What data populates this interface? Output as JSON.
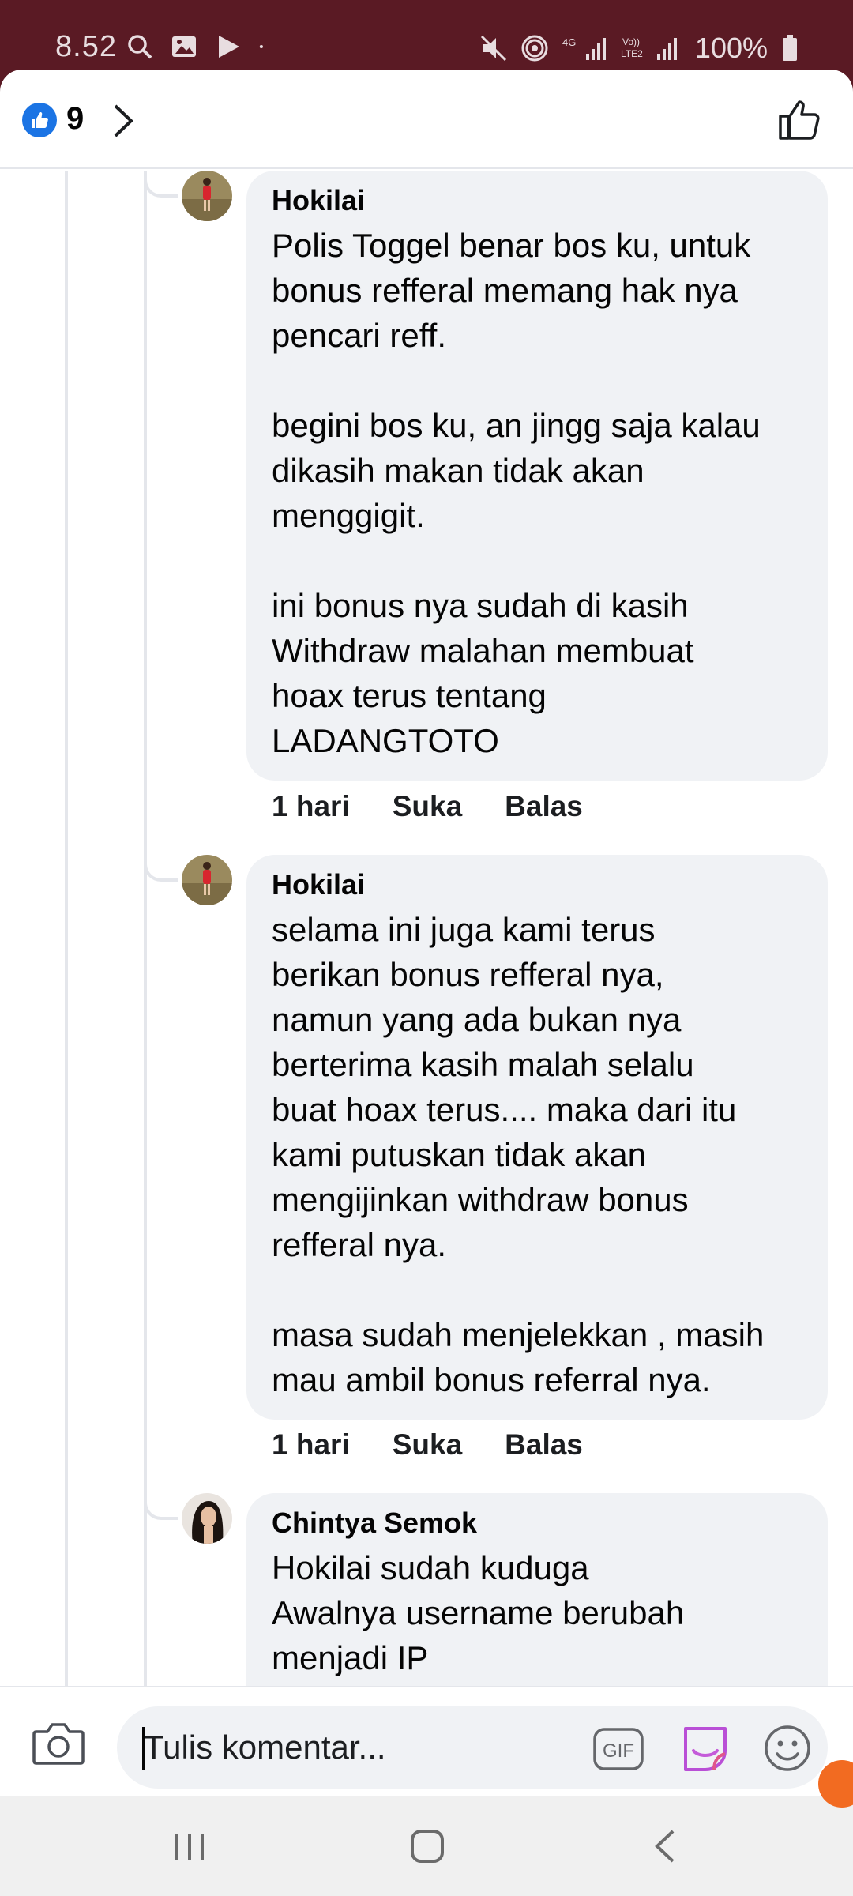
{
  "status_bar": {
    "time": "8.52",
    "network_label": "4G",
    "volte_label": "Vo)) LTE2",
    "battery": "100%"
  },
  "header": {
    "reaction_count": "9",
    "like_badge_color": "#1b74e4"
  },
  "comments": [
    {
      "author": "Hokilai",
      "text": "Polis Toggel benar bos ku, untuk\nbonus refferal memang hak nya\npencari reff.\n\nbegini bos ku, an jingg saja kalau\ndikasih makan tidak akan\nmenggigit.\n\nini bonus nya sudah di kasih\nWithdraw malahan membuat\nhoax terus tentang\nLADANGTOTO",
      "time": "1 hari",
      "like_label": "Suka",
      "reply_label": "Balas"
    },
    {
      "author": "Hokilai",
      "text": "selama ini juga kami terus\nberikan bonus refferal nya,\nnamun yang ada bukan nya\nberterima kasih malah selalu\nbuat hoax terus.... maka dari itu\nkami putuskan tidak akan\nmengijinkan withdraw bonus\nrefferal nya.\n\nmasa sudah menjelekkan , masih\nmau ambil bonus referral nya.",
      "time": "1 hari",
      "like_label": "Suka",
      "reply_label": "Balas"
    },
    {
      "author": "Chintya Semok",
      "text": "Hokilai sudah kuduga\nAwalnya username berubah\nmenjadi IP",
      "time": "",
      "like_label": "",
      "reply_label": ""
    }
  ],
  "composer": {
    "placeholder": "Tulis komentar...",
    "gif_label": "GIF"
  },
  "icons": {
    "camera": "camera-icon",
    "gif": "gif-icon",
    "sticker": "sticker-icon",
    "emoji": "emoji-icon",
    "like": "like-icon"
  }
}
